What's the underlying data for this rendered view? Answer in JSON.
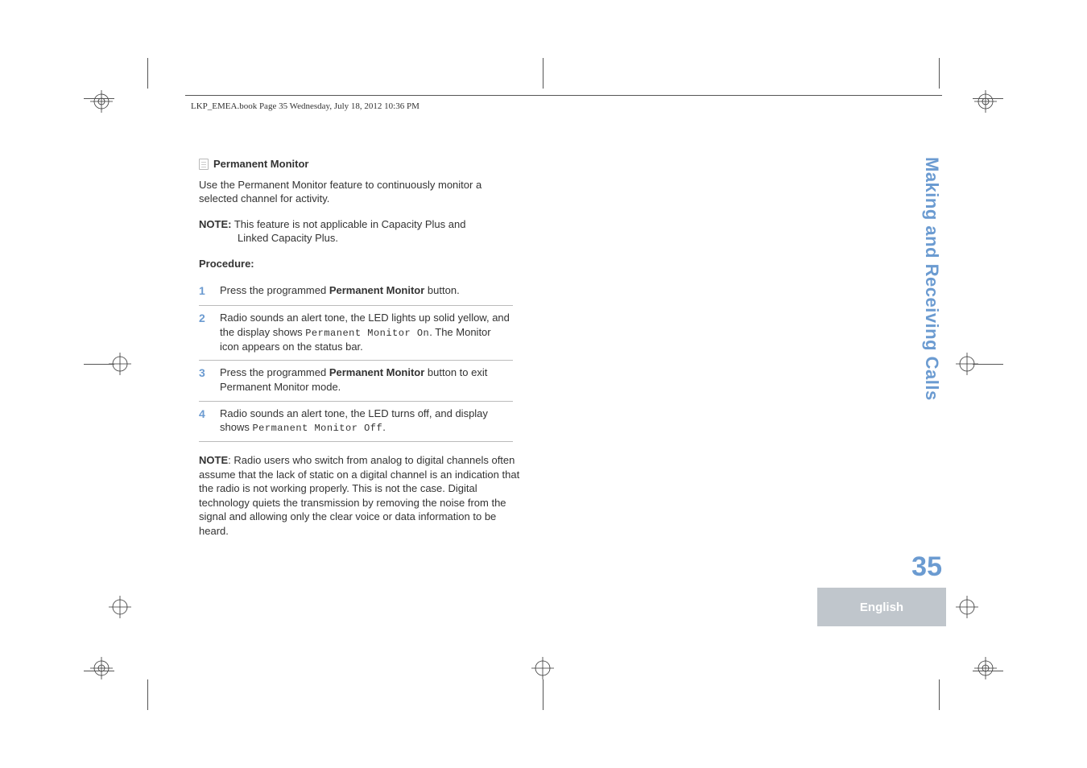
{
  "header": {
    "running_head": "LKP_EMEA.book  Page 35  Wednesday, July 18, 2012  10:36 PM"
  },
  "section": {
    "title": "Permanent Monitor",
    "intro": "Use the Permanent Monitor feature to continuously monitor a selected channel for activity.",
    "note_label": "NOTE:",
    "note_text_line1": "This feature is not applicable in Capacity Plus and",
    "note_text_line2": "Linked Capacity Plus.",
    "procedure_label": "Procedure:",
    "steps": [
      {
        "num": "1",
        "pre": "Press the programmed ",
        "bold": "Permanent Monitor",
        "post": " button."
      },
      {
        "num": "2",
        "pre": "Radio sounds an alert tone, the LED lights up solid yellow, and the display shows ",
        "lcd": "Permanent Monitor On",
        "post": ". The Monitor icon appears on the status bar."
      },
      {
        "num": "3",
        "pre": "Press the programmed ",
        "bold": "Permanent Monitor",
        "post": " button to exit Permanent Monitor mode."
      },
      {
        "num": "4",
        "pre": "Radio sounds an alert tone, the LED turns off, and display shows ",
        "lcd": "Permanent Monitor Off",
        "post": "."
      }
    ],
    "after_note_label": "NOTE",
    "after_note_text": ": Radio users who switch from analog to digital channels often assume that the lack of static on a digital channel is an indication that the radio is not working properly. This is not the case. Digital technology quiets the transmission by removing the noise from the signal and allowing only the clear voice or data information to be heard."
  },
  "sidebar": {
    "chapter_title": "Making and Receiving Calls",
    "page_number": "35",
    "language": "English"
  }
}
